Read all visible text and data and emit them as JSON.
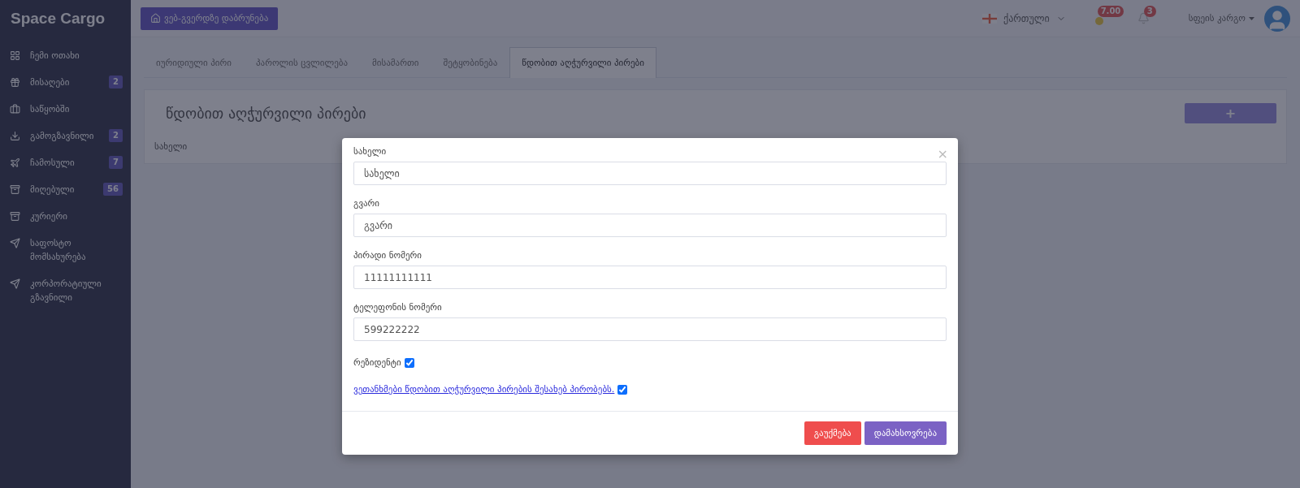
{
  "sidebar": {
    "brand": "Space Cargo",
    "items": [
      {
        "kind": "grid",
        "label": "ჩემი ოთახი"
      },
      {
        "kind": "gift",
        "label": "მისაღები",
        "badge": "2"
      },
      {
        "kind": "briefcase",
        "label": "საწყობში"
      },
      {
        "kind": "download",
        "label": "გამოგზავნილი",
        "badge": "2"
      },
      {
        "kind": "plane",
        "label": "ჩამოსული",
        "badge": "7"
      },
      {
        "kind": "archive",
        "label": "მიღებული",
        "badge": "56"
      },
      {
        "kind": "archive",
        "label": "კურიერი"
      },
      {
        "kind": "send",
        "label": "საფოსტო მომსახურება"
      },
      {
        "kind": "send-outline",
        "label": "კორპორატიული გზავნილი"
      }
    ]
  },
  "topbar": {
    "home_button": "ვებ-გვერდზე დაბრუნება",
    "language": "ქართული",
    "balance": "7.00",
    "notifications": "3",
    "user": "სფეის კარგო"
  },
  "tabs": [
    {
      "label": "იურიდიული პირი",
      "selected": false
    },
    {
      "label": "პაროლის ცვლილება",
      "selected": false
    },
    {
      "label": "მისამართი",
      "selected": false
    },
    {
      "label": "შეტყობინება",
      "selected": false
    },
    {
      "label": "წდობით აღჭურვილი პირები",
      "selected": true
    }
  ],
  "card": {
    "title": "წდობით აღჭურვილი პირები",
    "add_button": "+",
    "columns": [
      "სახელი"
    ]
  },
  "modal": {
    "close": "×",
    "fields": [
      {
        "label": "სახელი",
        "placeholder": "სახელი"
      },
      {
        "label": "გვარი",
        "placeholder": "გვარი"
      },
      {
        "label": "პირადი ნომერი",
        "value": "11111111111"
      },
      {
        "label": "ტელეფონის ნომერი",
        "value": "599222222"
      }
    ],
    "checkboxes": [
      {
        "kind": "plain",
        "label": "რეზიდენტი",
        "checked": true
      },
      {
        "kind": "link",
        "label": "ვეთანხმები წდობით აღჭურვილი პირების შესახებ პირობებს.",
        "checked": true
      }
    ],
    "buttons": [
      {
        "kind": "cancel",
        "label": "გაუქმება"
      },
      {
        "kind": "save",
        "label": "დამახსოვრება"
      }
    ]
  }
}
